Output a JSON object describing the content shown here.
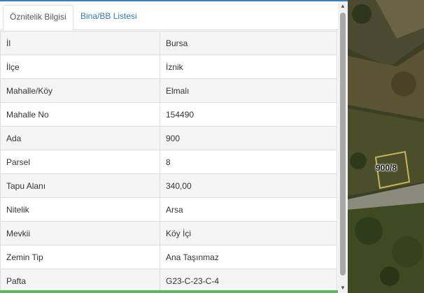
{
  "tabs": [
    {
      "label": "Öznitelik Bilgisi",
      "active": true
    },
    {
      "label": "Bina/BB Listesi",
      "active": false
    }
  ],
  "attributes": [
    {
      "key": "İl",
      "value": "Bursa"
    },
    {
      "key": "İlçe",
      "value": "İznik"
    },
    {
      "key": "Mahalle/Köy",
      "value": "Elmalı"
    },
    {
      "key": "Mahalle No",
      "value": "154490"
    },
    {
      "key": "Ada",
      "value": "900"
    },
    {
      "key": "Parsel",
      "value": "8"
    },
    {
      "key": "Tapu Alanı",
      "value": "340,00"
    },
    {
      "key": "Nitelik",
      "value": "Arsa"
    },
    {
      "key": "Mevkii",
      "value": "Köy İçi"
    },
    {
      "key": "Zemin Tip",
      "value": "Ana Taşınmaz"
    },
    {
      "key": "Pafta",
      "value": "G23-C-23-C-4"
    }
  ],
  "map": {
    "parcel_label": "900/8"
  },
  "colors": {
    "accent": "#3a7fc0",
    "link": "#337ab7",
    "status_bar": "#5cb85c",
    "parcel_outline": "#c8b45a"
  }
}
